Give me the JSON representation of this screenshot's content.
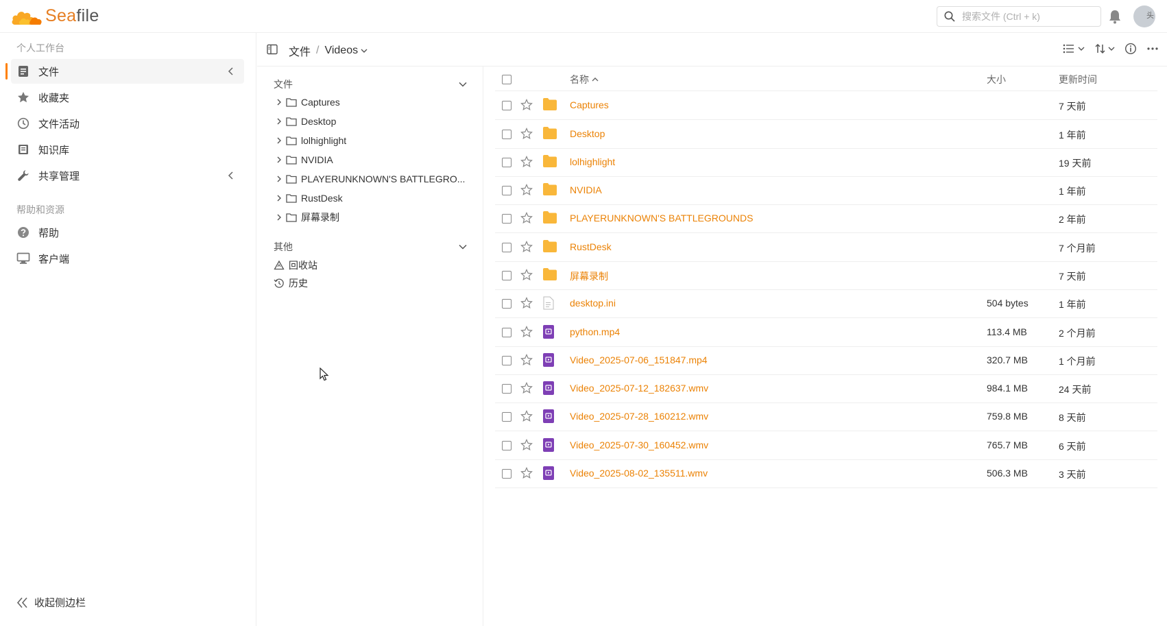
{
  "app": {
    "name_prefix": "Sea",
    "name_suffix": "file"
  },
  "search": {
    "placeholder": "搜索文件 (Ctrl + k)"
  },
  "avatar_alt": "头",
  "sidebar": {
    "section_workspace": "个人工作台",
    "items": [
      {
        "label": "文件",
        "icon": "file-icon",
        "active": true,
        "chevron": true
      },
      {
        "label": "收藏夹",
        "icon": "star-icon",
        "active": false,
        "chevron": false
      },
      {
        "label": "文件活动",
        "icon": "clock-icon",
        "active": false,
        "chevron": false
      },
      {
        "label": "知识库",
        "icon": "book-icon",
        "active": false,
        "chevron": false
      },
      {
        "label": "共享管理",
        "icon": "wrench-icon",
        "active": false,
        "chevron": true
      }
    ],
    "section_help": "帮助和资源",
    "help_items": [
      {
        "label": "帮助",
        "icon": "question-icon"
      },
      {
        "label": "客户端",
        "icon": "monitor-icon"
      }
    ],
    "collapse_label": "收起侧边栏"
  },
  "toolbar": {
    "root": "文件",
    "separator": "/",
    "current": "Videos"
  },
  "tree": {
    "files_heading": "文件",
    "folders": [
      "Captures",
      "Desktop",
      "lolhighlight",
      "NVIDIA",
      "PLAYERUNKNOWN'S BATTLEGRO...",
      "RustDesk",
      "屏幕录制"
    ],
    "other_heading": "其他",
    "other_items": [
      {
        "label": "回收站",
        "icon": "trash-icon"
      },
      {
        "label": "历史",
        "icon": "history-icon"
      }
    ]
  },
  "list": {
    "columns": {
      "name": "名称",
      "size": "大小",
      "modified": "更新时间"
    },
    "rows": [
      {
        "name": "Captures",
        "type": "folder",
        "size": "",
        "time": "7 天前"
      },
      {
        "name": "Desktop",
        "type": "folder",
        "size": "",
        "time": "1 年前"
      },
      {
        "name": "lolhighlight",
        "type": "folder",
        "size": "",
        "time": "19 天前"
      },
      {
        "name": "NVIDIA",
        "type": "folder",
        "size": "",
        "time": "1 年前"
      },
      {
        "name": "PLAYERUNKNOWN'S BATTLEGROUNDS",
        "type": "folder",
        "size": "",
        "time": "2 年前"
      },
      {
        "name": "RustDesk",
        "type": "folder",
        "size": "",
        "time": "7 个月前"
      },
      {
        "name": "屏幕录制",
        "type": "folder",
        "size": "",
        "time": "7 天前"
      },
      {
        "name": "desktop.ini",
        "type": "text",
        "size": "504 bytes",
        "time": "1 年前"
      },
      {
        "name": "python.mp4",
        "type": "video",
        "size": "113.4 MB",
        "time": "2 个月前"
      },
      {
        "name": "Video_2025-07-06_151847.mp4",
        "type": "video",
        "size": "320.7 MB",
        "time": "1 个月前"
      },
      {
        "name": "Video_2025-07-12_182637.wmv",
        "type": "video",
        "size": "984.1 MB",
        "time": "24 天前"
      },
      {
        "name": "Video_2025-07-28_160212.wmv",
        "type": "video",
        "size": "759.8 MB",
        "time": "8 天前"
      },
      {
        "name": "Video_2025-07-30_160452.wmv",
        "type": "video",
        "size": "765.7 MB",
        "time": "6 天前"
      },
      {
        "name": "Video_2025-08-02_135511.wmv",
        "type": "video",
        "size": "506.3 MB",
        "time": "3 天前"
      }
    ]
  },
  "colors": {
    "accent": "#eb8205",
    "folder": "#f9b73a",
    "video": "#7e3fb5"
  }
}
